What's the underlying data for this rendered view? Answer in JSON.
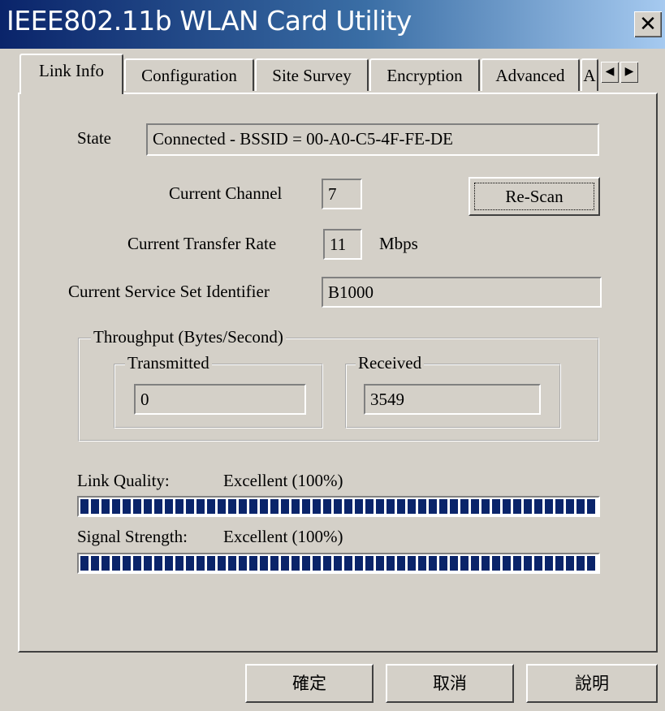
{
  "window": {
    "title": "IEEE802.11b WLAN Card Utility",
    "close_glyph": "✕"
  },
  "tabs": [
    {
      "label": "Link Info",
      "active": true
    },
    {
      "label": "Configuration"
    },
    {
      "label": "Site Survey"
    },
    {
      "label": "Encryption"
    },
    {
      "label": "Advanced"
    },
    {
      "label": "A"
    }
  ],
  "tab_scroll": {
    "left_icon": "◀",
    "right_icon": "▶"
  },
  "link_info": {
    "state_label": "State",
    "state_value": "Connected - BSSID = 00-A0-C5-4F-FE-DE",
    "channel_label": "Current Channel",
    "channel_value": "7",
    "rescan_label": "Re-Scan",
    "rate_label": "Current Transfer Rate",
    "rate_value": "11",
    "rate_unit": "Mbps",
    "ssid_label": "Current Service Set Identifier",
    "ssid_value": "B1000",
    "throughput": {
      "label": "Throughput (Bytes/Second)",
      "transmitted_label": "Transmitted",
      "transmitted_value": "0",
      "received_label": "Received",
      "received_value": "3549"
    },
    "link_quality_label": "Link Quality:",
    "link_quality_value": "Excellent (100%)",
    "link_quality_level": 1.0,
    "signal_strength_label": "Signal Strength:",
    "signal_strength_value": "Excellent (100%)",
    "signal_strength_level": 1.0
  },
  "buttons": {
    "ok": "確定",
    "cancel": "取消",
    "help": "說明"
  },
  "colors": {
    "title_start": "#0a246a",
    "title_end": "#a6caf0",
    "bar_fill": "#0a246a",
    "face": "#d4d0c8"
  }
}
